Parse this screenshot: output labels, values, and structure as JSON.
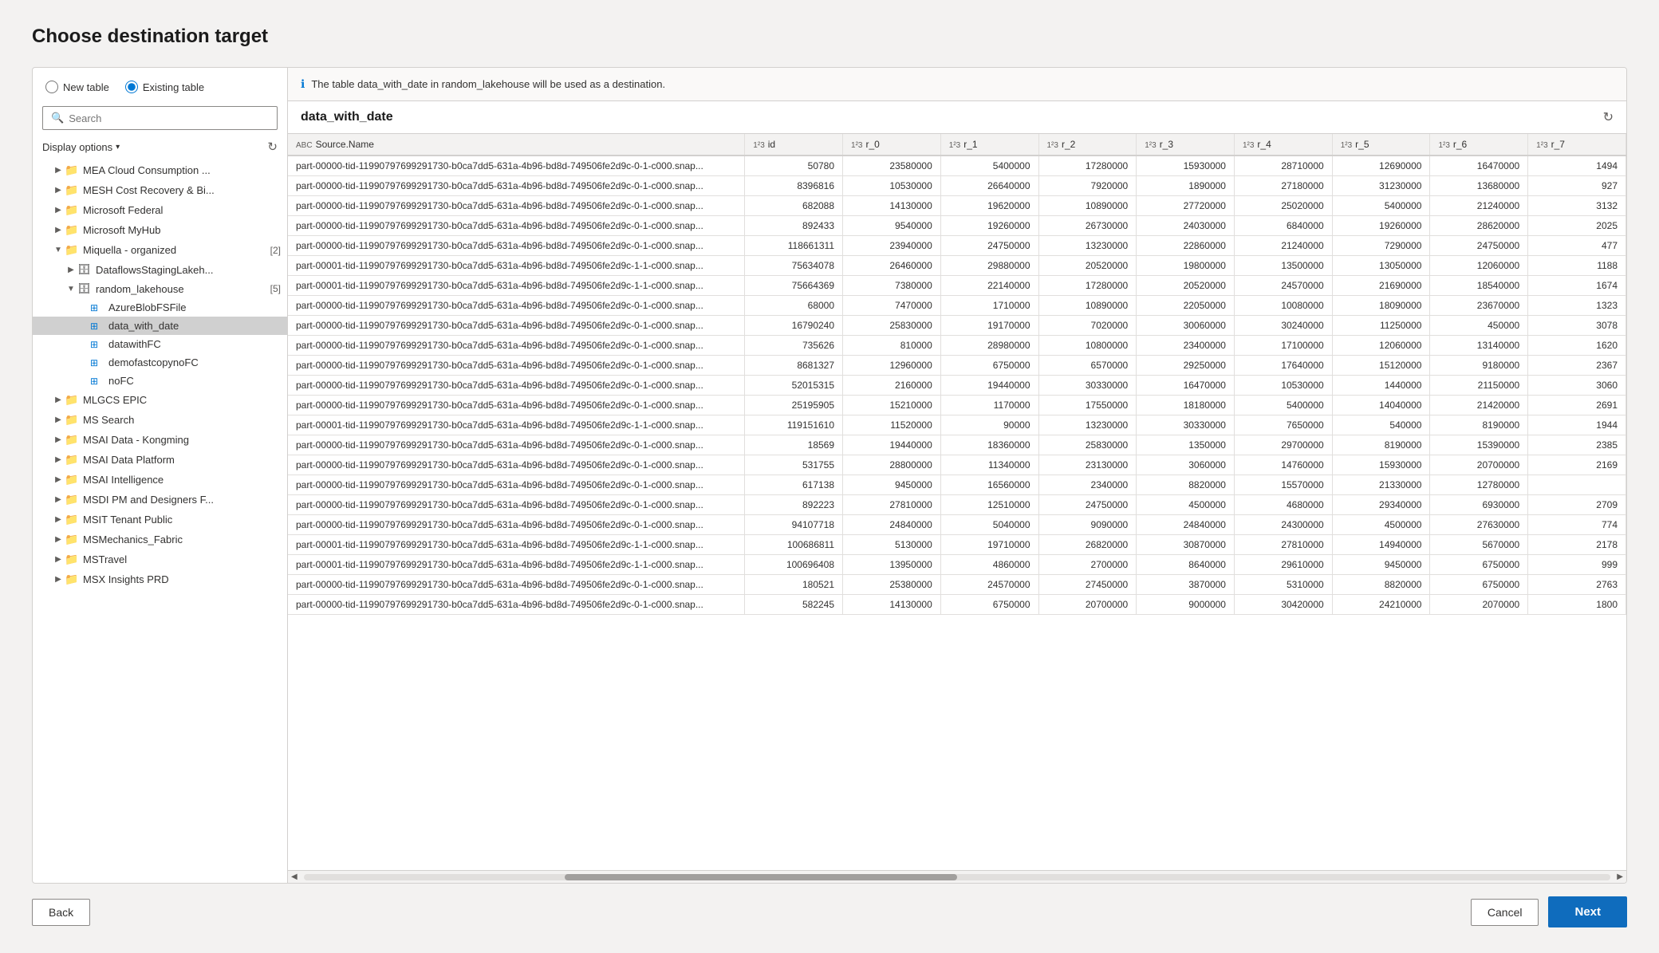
{
  "page": {
    "title": "Choose destination target"
  },
  "radio_options": {
    "new_table": "New table",
    "existing_table": "Existing table"
  },
  "search": {
    "placeholder": "Search"
  },
  "display_options": {
    "label": "Display options"
  },
  "info_bar": {
    "message": "The table data_with_date in random_lakehouse will be used as a destination."
  },
  "table": {
    "name": "data_with_date"
  },
  "columns": [
    {
      "label": "Source.Name",
      "type": "ABC"
    },
    {
      "label": "id",
      "type": "1²3"
    },
    {
      "label": "r_0",
      "type": "1²3"
    },
    {
      "label": "r_1",
      "type": "1²3"
    },
    {
      "label": "r_2",
      "type": "1²3"
    },
    {
      "label": "r_3",
      "type": "1²3"
    },
    {
      "label": "r_4",
      "type": "1²3"
    },
    {
      "label": "r_5",
      "type": "1²3"
    },
    {
      "label": "r_6",
      "type": "1²3"
    },
    {
      "label": "r_7",
      "type": "1²3"
    }
  ],
  "rows": [
    [
      "part-00000-tid-11990797699291730-b0ca7dd5-631a-4b96-bd8d-749506fe2d9c-0-1-c000.snap...",
      "50780",
      "23580000",
      "5400000",
      "17280000",
      "15930000",
      "28710000",
      "12690000",
      "16470000",
      "1494"
    ],
    [
      "part-00000-tid-11990797699291730-b0ca7dd5-631a-4b96-bd8d-749506fe2d9c-0-1-c000.snap...",
      "8396816",
      "10530000",
      "26640000",
      "7920000",
      "1890000",
      "27180000",
      "31230000",
      "13680000",
      "927"
    ],
    [
      "part-00000-tid-11990797699291730-b0ca7dd5-631a-4b96-bd8d-749506fe2d9c-0-1-c000.snap...",
      "682088",
      "14130000",
      "19620000",
      "10890000",
      "27720000",
      "25020000",
      "5400000",
      "21240000",
      "3132"
    ],
    [
      "part-00000-tid-11990797699291730-b0ca7dd5-631a-4b96-bd8d-749506fe2d9c-0-1-c000.snap...",
      "892433",
      "9540000",
      "19260000",
      "26730000",
      "24030000",
      "6840000",
      "19260000",
      "28620000",
      "2025"
    ],
    [
      "part-00000-tid-11990797699291730-b0ca7dd5-631a-4b96-bd8d-749506fe2d9c-0-1-c000.snap...",
      "118661311",
      "23940000",
      "24750000",
      "13230000",
      "22860000",
      "21240000",
      "7290000",
      "24750000",
      "477"
    ],
    [
      "part-00001-tid-11990797699291730-b0ca7dd5-631a-4b96-bd8d-749506fe2d9c-1-1-c000.snap...",
      "75634078",
      "26460000",
      "29880000",
      "20520000",
      "19800000",
      "13500000",
      "13050000",
      "12060000",
      "1188"
    ],
    [
      "part-00001-tid-11990797699291730-b0ca7dd5-631a-4b96-bd8d-749506fe2d9c-1-1-c000.snap...",
      "75664369",
      "7380000",
      "22140000",
      "17280000",
      "20520000",
      "24570000",
      "21690000",
      "18540000",
      "1674"
    ],
    [
      "part-00000-tid-11990797699291730-b0ca7dd5-631a-4b96-bd8d-749506fe2d9c-0-1-c000.snap...",
      "68000",
      "7470000",
      "1710000",
      "10890000",
      "22050000",
      "10080000",
      "18090000",
      "23670000",
      "1323"
    ],
    [
      "part-00000-tid-11990797699291730-b0ca7dd5-631a-4b96-bd8d-749506fe2d9c-0-1-c000.snap...",
      "16790240",
      "25830000",
      "19170000",
      "7020000",
      "30060000",
      "30240000",
      "11250000",
      "450000",
      "3078"
    ],
    [
      "part-00000-tid-11990797699291730-b0ca7dd5-631a-4b96-bd8d-749506fe2d9c-0-1-c000.snap...",
      "735626",
      "810000",
      "28980000",
      "10800000",
      "23400000",
      "17100000",
      "12060000",
      "13140000",
      "1620"
    ],
    [
      "part-00000-tid-11990797699291730-b0ca7dd5-631a-4b96-bd8d-749506fe2d9c-0-1-c000.snap...",
      "8681327",
      "12960000",
      "6750000",
      "6570000",
      "29250000",
      "17640000",
      "15120000",
      "9180000",
      "2367"
    ],
    [
      "part-00000-tid-11990797699291730-b0ca7dd5-631a-4b96-bd8d-749506fe2d9c-0-1-c000.snap...",
      "52015315",
      "2160000",
      "19440000",
      "30330000",
      "16470000",
      "10530000",
      "1440000",
      "21150000",
      "3060"
    ],
    [
      "part-00000-tid-11990797699291730-b0ca7dd5-631a-4b96-bd8d-749506fe2d9c-0-1-c000.snap...",
      "25195905",
      "15210000",
      "1170000",
      "17550000",
      "18180000",
      "5400000",
      "14040000",
      "21420000",
      "2691"
    ],
    [
      "part-00001-tid-11990797699291730-b0ca7dd5-631a-4b96-bd8d-749506fe2d9c-1-1-c000.snap...",
      "119151610",
      "11520000",
      "90000",
      "13230000",
      "30330000",
      "7650000",
      "540000",
      "8190000",
      "1944"
    ],
    [
      "part-00000-tid-11990797699291730-b0ca7dd5-631a-4b96-bd8d-749506fe2d9c-0-1-c000.snap...",
      "18569",
      "19440000",
      "18360000",
      "25830000",
      "1350000",
      "29700000",
      "8190000",
      "15390000",
      "2385"
    ],
    [
      "part-00000-tid-11990797699291730-b0ca7dd5-631a-4b96-bd8d-749506fe2d9c-0-1-c000.snap...",
      "531755",
      "28800000",
      "11340000",
      "23130000",
      "3060000",
      "14760000",
      "15930000",
      "20700000",
      "2169"
    ],
    [
      "part-00000-tid-11990797699291730-b0ca7dd5-631a-4b96-bd8d-749506fe2d9c-0-1-c000.snap...",
      "617138",
      "9450000",
      "16560000",
      "2340000",
      "8820000",
      "15570000",
      "21330000",
      "12780000",
      ""
    ],
    [
      "part-00000-tid-11990797699291730-b0ca7dd5-631a-4b96-bd8d-749506fe2d9c-0-1-c000.snap...",
      "892223",
      "27810000",
      "12510000",
      "24750000",
      "4500000",
      "4680000",
      "29340000",
      "6930000",
      "2709"
    ],
    [
      "part-00000-tid-11990797699291730-b0ca7dd5-631a-4b96-bd8d-749506fe2d9c-0-1-c000.snap...",
      "94107718",
      "24840000",
      "5040000",
      "9090000",
      "24840000",
      "24300000",
      "4500000",
      "27630000",
      "774"
    ],
    [
      "part-00001-tid-11990797699291730-b0ca7dd5-631a-4b96-bd8d-749506fe2d9c-1-1-c000.snap...",
      "100686811",
      "5130000",
      "19710000",
      "26820000",
      "30870000",
      "27810000",
      "14940000",
      "5670000",
      "2178"
    ],
    [
      "part-00001-tid-11990797699291730-b0ca7dd5-631a-4b96-bd8d-749506fe2d9c-1-1-c000.snap...",
      "100696408",
      "13950000",
      "4860000",
      "2700000",
      "8640000",
      "29610000",
      "9450000",
      "6750000",
      "999"
    ],
    [
      "part-00000-tid-11990797699291730-b0ca7dd5-631a-4b96-bd8d-749506fe2d9c-0-1-c000.snap...",
      "180521",
      "25380000",
      "24570000",
      "27450000",
      "3870000",
      "5310000",
      "8820000",
      "6750000",
      "2763"
    ],
    [
      "part-00000-tid-11990797699291730-b0ca7dd5-631a-4b96-bd8d-749506fe2d9c-0-1-c000.snap...",
      "582245",
      "14130000",
      "6750000",
      "20700000",
      "9000000",
      "30420000",
      "24210000",
      "2070000",
      "1800"
    ]
  ],
  "tree": {
    "items": [
      {
        "id": "mea",
        "label": "MEA Cloud Consumption ...",
        "level": 1,
        "type": "folder",
        "expanded": false
      },
      {
        "id": "mesh",
        "label": "MESH Cost Recovery & Bi...",
        "level": 1,
        "type": "folder",
        "expanded": false
      },
      {
        "id": "msfederal",
        "label": "Microsoft Federal",
        "level": 1,
        "type": "folder",
        "expanded": false
      },
      {
        "id": "myhub",
        "label": "Microsoft MyHub",
        "level": 1,
        "type": "folder",
        "expanded": false
      },
      {
        "id": "miquella",
        "label": "Miquella - organized",
        "level": 1,
        "type": "folder",
        "expanded": true,
        "count": "2"
      },
      {
        "id": "dataflows",
        "label": "DataflowsStagingLakeh...",
        "level": 2,
        "type": "lakehouse",
        "expanded": false
      },
      {
        "id": "random_lh",
        "label": "random_lakehouse",
        "level": 2,
        "type": "lakehouse",
        "expanded": true,
        "count": "5"
      },
      {
        "id": "azureblob",
        "label": "AzureBlobFSFile",
        "level": 3,
        "type": "table"
      },
      {
        "id": "data_with_date",
        "label": "data_with_date",
        "level": 3,
        "type": "table",
        "selected": true
      },
      {
        "id": "datawithfc",
        "label": "datawithFC",
        "level": 3,
        "type": "table"
      },
      {
        "id": "demofastcopy",
        "label": "demofastcopynoFC",
        "level": 3,
        "type": "table"
      },
      {
        "id": "nofc",
        "label": "noFC",
        "level": 3,
        "type": "table"
      },
      {
        "id": "mlgcs",
        "label": "MLGCS EPIC",
        "level": 1,
        "type": "folder",
        "expanded": false
      },
      {
        "id": "mssearch",
        "label": "MS Search",
        "level": 1,
        "type": "folder",
        "expanded": false
      },
      {
        "id": "msai_kong",
        "label": "MSAI Data - Kongming",
        "level": 1,
        "type": "folder",
        "expanded": false
      },
      {
        "id": "msai_platform",
        "label": "MSAI Data Platform",
        "level": 1,
        "type": "folder",
        "expanded": false
      },
      {
        "id": "msai_intel",
        "label": "MSAI Intelligence",
        "level": 1,
        "type": "folder",
        "expanded": false
      },
      {
        "id": "msdi",
        "label": "MSDI PM and Designers F...",
        "level": 1,
        "type": "folder",
        "expanded": false
      },
      {
        "id": "msit",
        "label": "MSIT Tenant Public",
        "level": 1,
        "type": "folder",
        "expanded": false
      },
      {
        "id": "msmechanics",
        "label": "MSMechanics_Fabric",
        "level": 1,
        "type": "folder",
        "expanded": false
      },
      {
        "id": "mstravel",
        "label": "MSTravel",
        "level": 1,
        "type": "folder",
        "expanded": false
      },
      {
        "id": "msx",
        "label": "MSX Insights PRD",
        "level": 1,
        "type": "folder",
        "expanded": false
      }
    ]
  },
  "buttons": {
    "back": "Back",
    "cancel": "Cancel",
    "next": "Next"
  }
}
